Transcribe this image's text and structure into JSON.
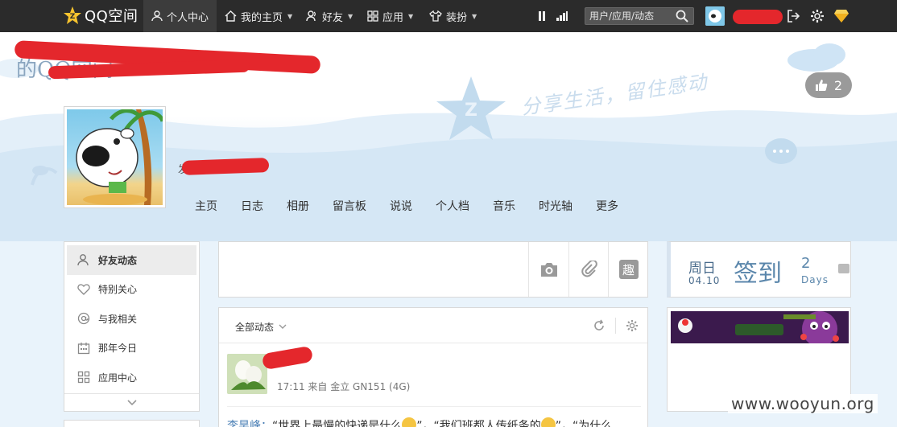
{
  "topbar": {
    "logo_text": "QQ空间",
    "menu": [
      {
        "label": "个人中心"
      },
      {
        "label": "我的主页"
      },
      {
        "label": "好友"
      },
      {
        "label": "应用"
      },
      {
        "label": "装扮"
      }
    ],
    "search_placeholder": "用户/应用/动态"
  },
  "banner": {
    "space_title": "的QQ空间",
    "slogan": "分享生活，留住感动",
    "like_count": "2",
    "friends_prefix": "发者"
  },
  "nav": [
    "主页",
    "日志",
    "相册",
    "留言板",
    "说说",
    "个人档",
    "音乐",
    "时光轴",
    "更多"
  ],
  "sidebar": {
    "items": [
      {
        "label": "好友动态",
        "icon": "user-icon"
      },
      {
        "label": "特别关心",
        "icon": "heart-icon"
      },
      {
        "label": "与我相关",
        "icon": "at-icon"
      },
      {
        "label": "那年今日",
        "icon": "calendar-icon"
      },
      {
        "label": "应用中心",
        "icon": "grid-icon"
      }
    ]
  },
  "publisher": {
    "buttons": [
      "camera-icon",
      "paperclip-icon",
      "fun-icon"
    ],
    "fun_label": "趣"
  },
  "feed": {
    "filter_label": "全部动态",
    "meta": "17:11  来自 金立 GN151 (4G)",
    "post_name": "李昊峰：",
    "post_text_1": "“世界上最慢的快递是什么",
    "post_text_2": "”，“我们班都人传纸条的",
    "post_text_3": "”，“为什么"
  },
  "checkin": {
    "day": "周日",
    "date": "04.10",
    "label": "签到",
    "count": "2",
    "unit": "Days"
  },
  "watermark": "www.wooyun.org"
}
